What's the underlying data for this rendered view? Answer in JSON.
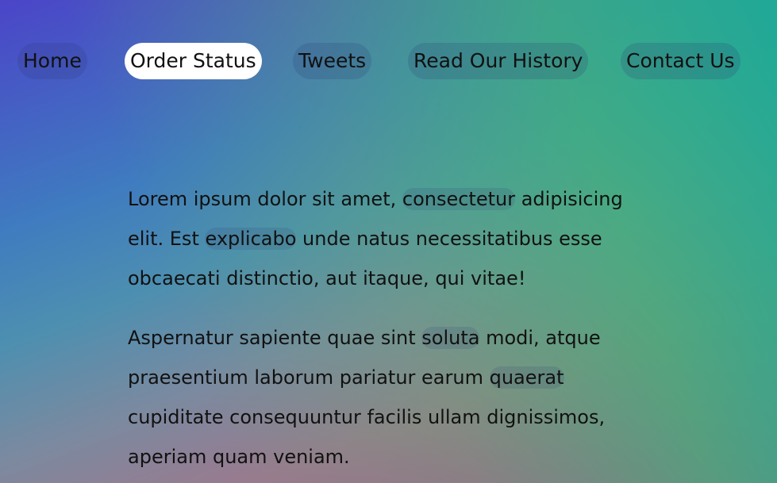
{
  "nav": {
    "items": [
      {
        "label": "Home",
        "active": false
      },
      {
        "label": "Order Status",
        "active": true
      },
      {
        "label": "Tweets",
        "active": false
      },
      {
        "label": "Read Our History",
        "active": false
      },
      {
        "label": "Contact Us",
        "active": false
      }
    ]
  },
  "content": {
    "p1": {
      "a": "Lorem ipsum dolor sit amet, ",
      "b": "consectetur",
      "c": " adipisicing elit. Est ",
      "d": "explicabo",
      "e": " unde natus necessitatibus esse obcaecati distinctio, aut itaque, qui vitae!"
    },
    "p2": {
      "a": "Aspernatur sapiente quae sint ",
      "b": "soluta",
      "c": " modi, atque praesentium laborum pariatur earum ",
      "d": "quaerat",
      "e": " cupiditate consequuntur facilis ullam dignissimos, aperiam quam veniam."
    }
  },
  "colors": {
    "gradient_top_left": "#4b45c8",
    "gradient_bottom_left": "#b04a92",
    "gradient_right": "#1eaa96",
    "active_pill": "#ffffff"
  }
}
